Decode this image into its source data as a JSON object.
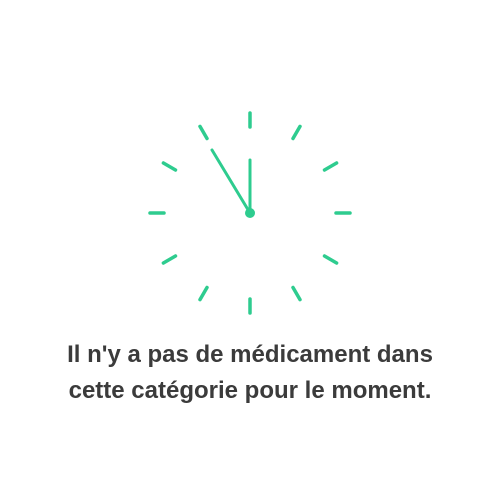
{
  "empty_state": {
    "icon": "clock-icon",
    "accent_color": "#2ecc8f",
    "text_color": "#3b3b3b",
    "message_line_1": "Il n'y a pas de médicament dans",
    "message_line_2": "cette catégorie pour le moment."
  }
}
